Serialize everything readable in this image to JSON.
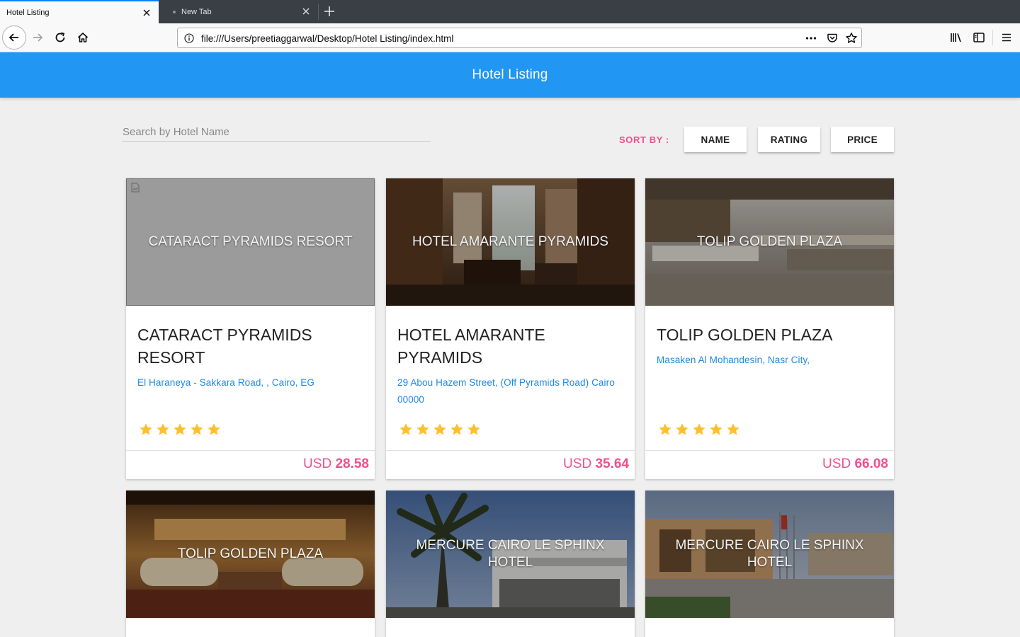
{
  "browser": {
    "tabs": [
      {
        "label": "Hotel Listing"
      },
      {
        "label": "New Tab"
      }
    ],
    "url": "file:///Users/preetiaggarwal/Desktop/Hotel Listing/index.html"
  },
  "header": {
    "title": "Hotel Listing"
  },
  "search": {
    "placeholder": "Search by Hotel Name",
    "value": ""
  },
  "sort": {
    "label": "SORT BY :",
    "buttons": [
      "NAME",
      "RATING",
      "PRICE"
    ]
  },
  "colors": {
    "header_bg": "#2196f3",
    "accent_pink": "#f0508c",
    "link_blue": "#1e88e5",
    "star": "#fbc02d"
  },
  "hotels": [
    {
      "image_title": "CATARACT PYRAMIDS RESORT",
      "name": "CATARACT PYRAMIDS RESORT",
      "address": "El Haraneya - Sakkara Road, , Cairo, EG",
      "rating": 5,
      "currency": "USD",
      "price": "28.58",
      "image": "broken"
    },
    {
      "image_title": "HOTEL AMARANTE PYRAMIDS",
      "name": "HOTEL AMARANTE PYRAMIDS",
      "address": "29 Abou Hazem Street, (Off Pyramids Road) Cairo 00000",
      "rating": 5,
      "currency": "USD",
      "price": "35.64",
      "image": "hotel-lobby-photo"
    },
    {
      "image_title": "TOLIP GOLDEN PLAZA",
      "name": "TOLIP GOLDEN PLAZA",
      "address": "Masaken Al Mohandesin, Nasr City,",
      "rating": 5,
      "currency": "USD",
      "price": "66.08",
      "image": "restaurant-buffet-photo"
    },
    {
      "image_title": "TOLIP GOLDEN PLAZA",
      "image": "lounge-photo"
    },
    {
      "image_title": "MERCURE CAIRO LE SPHINX HOTEL",
      "image": "hotel-facade-photo"
    },
    {
      "image_title": "MERCURE CAIRO LE SPHINX HOTEL",
      "image": "hotel-entrance-photo"
    }
  ]
}
